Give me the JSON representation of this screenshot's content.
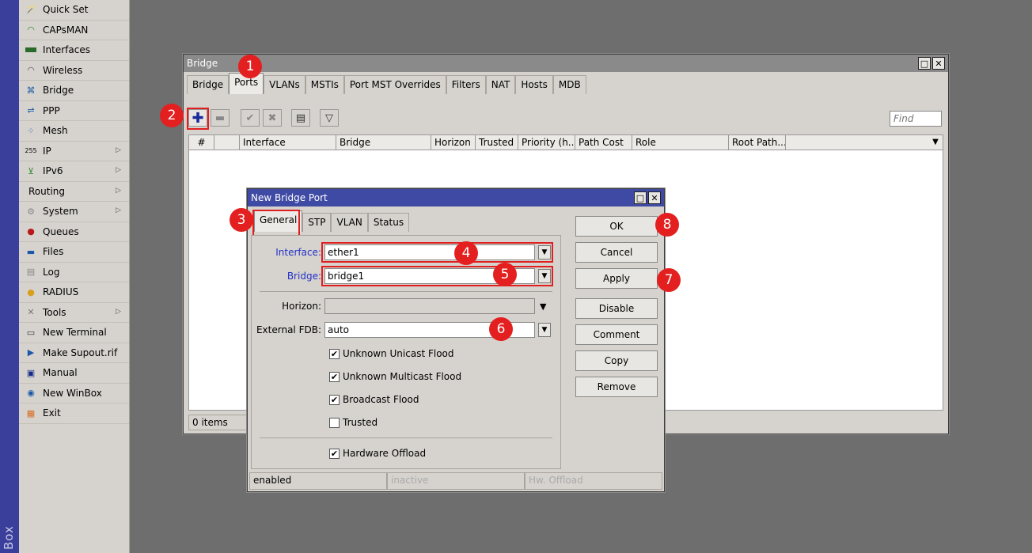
{
  "app": {
    "brand": "Box"
  },
  "sidebar": {
    "items": [
      {
        "label": "Quick Set",
        "icon": "wand-icon",
        "submenu": false
      },
      {
        "label": "CAPsMAN",
        "icon": "antenna-icon",
        "submenu": false
      },
      {
        "label": "Interfaces",
        "icon": "interfaces-icon",
        "submenu": false
      },
      {
        "label": "Wireless",
        "icon": "wireless-icon",
        "submenu": false
      },
      {
        "label": "Bridge",
        "icon": "bridge-icon",
        "submenu": false
      },
      {
        "label": "PPP",
        "icon": "ppp-icon",
        "submenu": false
      },
      {
        "label": "Mesh",
        "icon": "mesh-icon",
        "submenu": false
      },
      {
        "label": "IP",
        "icon": "ip-icon",
        "submenu": true
      },
      {
        "label": "IPv6",
        "icon": "ipv6-icon",
        "submenu": true
      },
      {
        "label": "Routing",
        "icon": "",
        "submenu": true
      },
      {
        "label": "System",
        "icon": "system-gear-icon",
        "submenu": true
      },
      {
        "label": "Queues",
        "icon": "queues-icon",
        "submenu": false
      },
      {
        "label": "Files",
        "icon": "folder-icon",
        "submenu": false
      },
      {
        "label": "Log",
        "icon": "log-icon",
        "submenu": false
      },
      {
        "label": "RADIUS",
        "icon": "radius-icon",
        "submenu": false
      },
      {
        "label": "Tools",
        "icon": "tools-icon",
        "submenu": true
      },
      {
        "label": "New Terminal",
        "icon": "terminal-icon",
        "submenu": false
      },
      {
        "label": "Make Supout.rif",
        "icon": "supout-icon",
        "submenu": false
      },
      {
        "label": "Manual",
        "icon": "manual-icon",
        "submenu": false
      },
      {
        "label": "New WinBox",
        "icon": "winbox-icon",
        "submenu": false
      },
      {
        "label": "Exit",
        "icon": "exit-icon",
        "submenu": false
      }
    ]
  },
  "bridge_window": {
    "title": "Bridge",
    "tabs": [
      "Bridge",
      "Ports",
      "VLANs",
      "MSTIs",
      "Port MST Overrides",
      "Filters",
      "NAT",
      "Hosts",
      "MDB"
    ],
    "active_tab": "Ports",
    "find_placeholder": "Find",
    "columns": [
      "#",
      "",
      "Interface",
      "Bridge",
      "Horizon",
      "Trusted",
      "Priority (h...",
      "Path Cost",
      "Role",
      "Root Path..."
    ],
    "status": "0 items"
  },
  "dialog": {
    "title": "New Bridge Port",
    "tabs": [
      "General",
      "STP",
      "VLAN",
      "Status"
    ],
    "active_tab": "General",
    "fields": {
      "interface_label": "Interface:",
      "interface_value": "ether1",
      "bridge_label": "Bridge:",
      "bridge_value": "bridge1",
      "horizon_label": "Horizon:",
      "horizon_value": "",
      "fdb_label": "External FDB:",
      "fdb_value": "auto"
    },
    "checkboxes": [
      {
        "label": "Unknown Unicast Flood",
        "checked": true
      },
      {
        "label": "Unknown Multicast Flood",
        "checked": true
      },
      {
        "label": "Broadcast Flood",
        "checked": true
      },
      {
        "label": "Trusted",
        "checked": false
      },
      {
        "label": "Hardware Offload",
        "checked": true
      }
    ],
    "buttons": [
      "OK",
      "Cancel",
      "Apply",
      "Disable",
      "Comment",
      "Copy",
      "Remove"
    ],
    "status": [
      "enabled",
      "inactive",
      "Hw. Offload"
    ]
  },
  "annotations": [
    "1",
    "2",
    "3",
    "4",
    "5",
    "6",
    "7",
    "8"
  ],
  "colors": {
    "highlight": "#e02020",
    "badge": "#e41f1f",
    "active_title": "#3e4aa4",
    "field_label_blue": "#2330c7"
  }
}
